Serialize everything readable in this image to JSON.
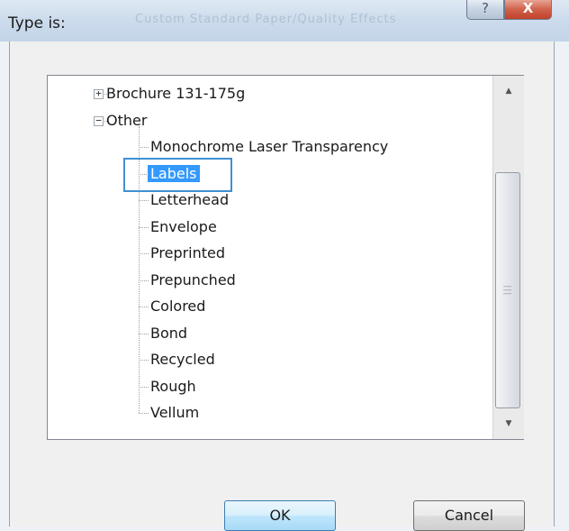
{
  "window": {
    "title": "Type is:",
    "ghost_text": "Custom  Standard  Paper/Quality  Effects",
    "help_symbol": "?",
    "close_symbol": "X"
  },
  "tree": {
    "items": [
      {
        "label": "Brochure 131-175g",
        "level": 0,
        "expander": "+"
      },
      {
        "label": "Other",
        "level": 0,
        "expander": "−"
      },
      {
        "label": "Monochrome Laser Transparency",
        "level": 1
      },
      {
        "label": "Labels",
        "level": 1,
        "selected": true
      },
      {
        "label": "Letterhead",
        "level": 1
      },
      {
        "label": "Envelope",
        "level": 1
      },
      {
        "label": "Preprinted",
        "level": 1
      },
      {
        "label": "Prepunched",
        "level": 1
      },
      {
        "label": "Colored",
        "level": 1
      },
      {
        "label": "Bond",
        "level": 1
      },
      {
        "label": "Recycled",
        "level": 1
      },
      {
        "label": "Rough",
        "level": 1
      },
      {
        "label": "Vellum",
        "level": 1
      }
    ]
  },
  "scrollbar": {
    "up_symbol": "▲",
    "down_symbol": "▼",
    "grip_symbol": "≡"
  },
  "buttons": {
    "ok_label": "OK",
    "cancel_label": "Cancel"
  }
}
